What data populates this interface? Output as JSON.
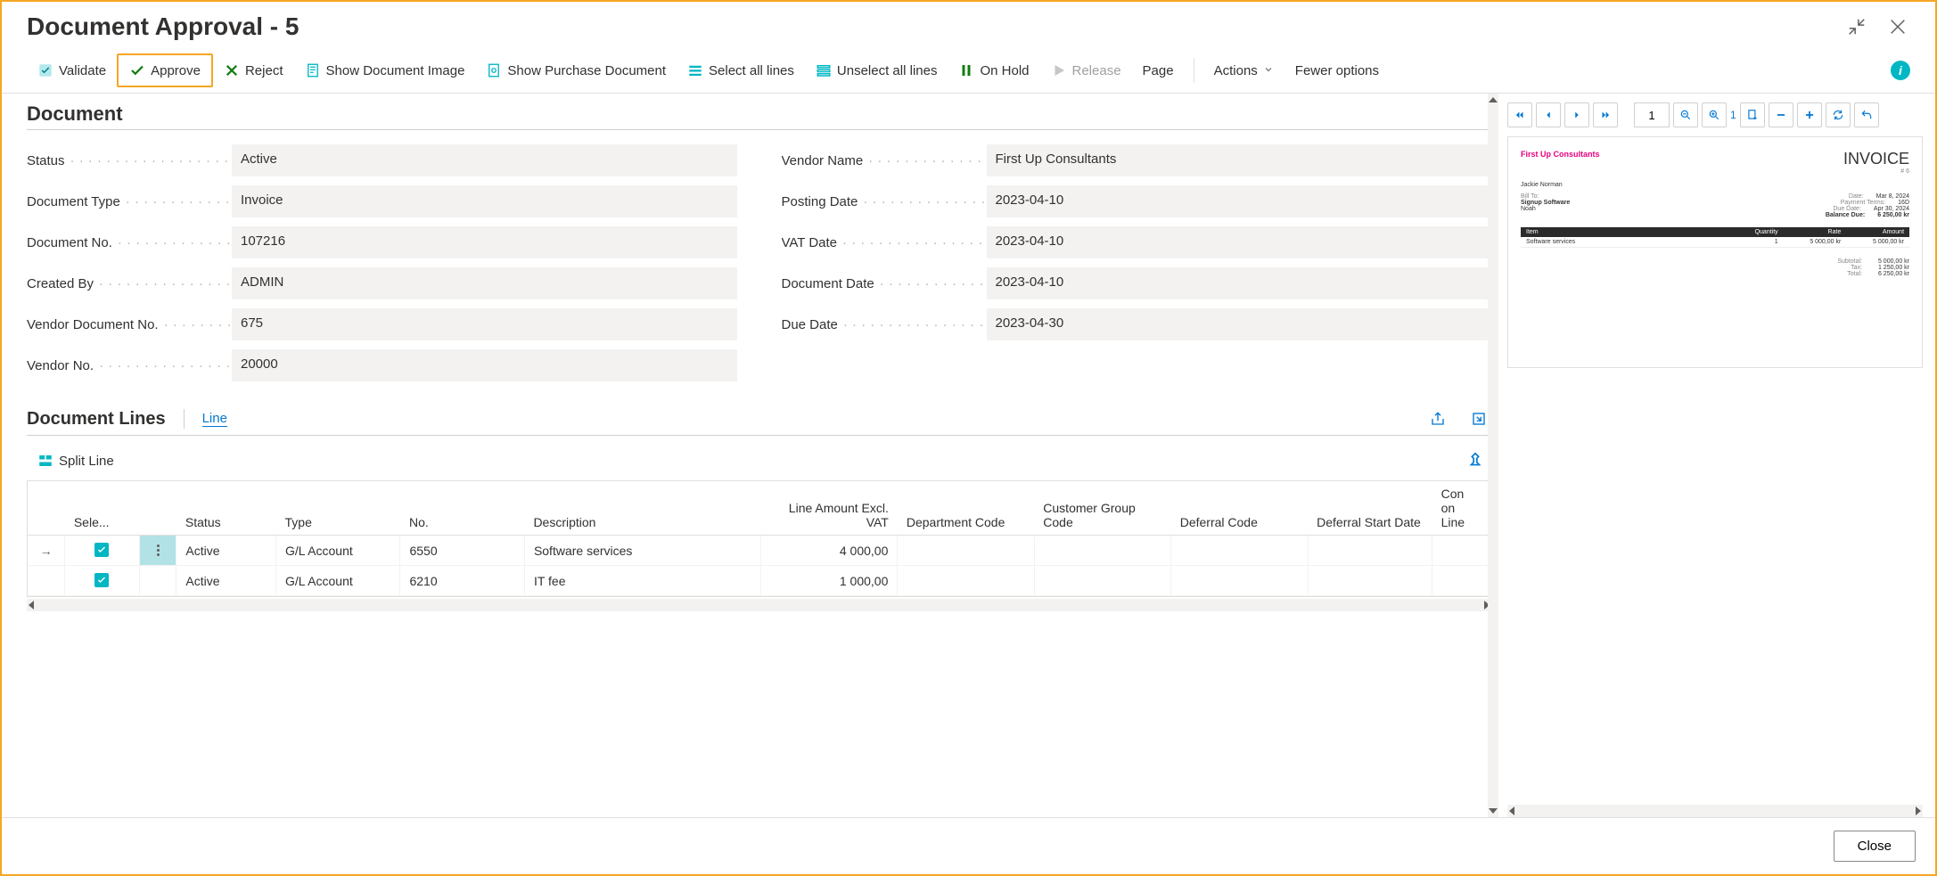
{
  "title": "Document Approval - 5",
  "toolbar": {
    "validate": "Validate",
    "approve": "Approve",
    "reject": "Reject",
    "show_image": "Show Document Image",
    "show_purchase": "Show Purchase Document",
    "select_all": "Select all lines",
    "unselect_all": "Unselect all lines",
    "on_hold": "On Hold",
    "release": "Release",
    "page": "Page",
    "actions": "Actions",
    "fewer": "Fewer options"
  },
  "section_document": "Document",
  "fields": {
    "status_label": "Status",
    "status_value": "Active",
    "doctype_label": "Document Type",
    "doctype_value": "Invoice",
    "docno_label": "Document No.",
    "docno_value": "107216",
    "createdby_label": "Created By",
    "createdby_value": "ADMIN",
    "vendordocno_label": "Vendor Document No.",
    "vendordocno_value": "675",
    "vendorno_label": "Vendor No.",
    "vendorno_value": "20000",
    "vendorname_label": "Vendor Name",
    "vendorname_value": "First Up Consultants",
    "posting_label": "Posting Date",
    "posting_value": "2023-04-10",
    "vatdate_label": "VAT Date",
    "vatdate_value": "2023-04-10",
    "docdate_label": "Document Date",
    "docdate_value": "2023-04-10",
    "duedate_label": "Due Date",
    "duedate_value": "2023-04-30"
  },
  "lines": {
    "heading": "Document Lines",
    "link": "Line",
    "split": "Split Line",
    "headers": {
      "sele": "Sele...",
      "status": "Status",
      "type": "Type",
      "no": "No.",
      "description": "Description",
      "amount": "Line Amount Excl. VAT",
      "dept": "Department Code",
      "custgroup": "Customer Group Code",
      "deferral": "Deferral Code",
      "defstart": "Deferral Start Date",
      "con": "Con on Line"
    },
    "rows": [
      {
        "status": "Active",
        "type": "G/L Account",
        "no": "6550",
        "desc": "Software services",
        "amount": "4 000,00",
        "dept": "",
        "custgroup": "",
        "deferral": "",
        "defstart": ""
      },
      {
        "status": "Active",
        "type": "G/L Account",
        "no": "6210",
        "desc": "IT fee",
        "amount": "1 000,00",
        "dept": "",
        "custgroup": "",
        "deferral": "",
        "defstart": ""
      }
    ]
  },
  "preview": {
    "page_input": "1",
    "zoom_suffix": "1",
    "brand": "First Up Consultants",
    "inv_title": "INVOICE",
    "inv_no": "# 6",
    "contact": "Jackie Norman",
    "billto_label": "Bill To:",
    "billto_line1": "Signup Software",
    "billto_line2": "Noah",
    "date_label": "Date:",
    "date_value": "Mar 8, 2024",
    "terms_label": "Payment Terms:",
    "terms_value": "16D",
    "due_label": "Due Date:",
    "due_value": "Apr 30, 2024",
    "bal_label": "Balance Due:",
    "bal_value": "6 250,00 kr",
    "th_item": "Item",
    "th_qty": "Quantity",
    "th_rate": "Rate",
    "th_amt": "Amount",
    "row_item": "Software services",
    "row_qty": "1",
    "row_rate": "5 000,00 kr",
    "row_amt": "5 000,00 kr",
    "subtotal_label": "Subtotal:",
    "subtotal_value": "5 000,00 kr",
    "tax_label": "Tax:",
    "tax_value": "1 250,00 kr",
    "total_label": "Total:",
    "total_value": "6 250,00 kr"
  },
  "footer": {
    "close": "Close"
  }
}
